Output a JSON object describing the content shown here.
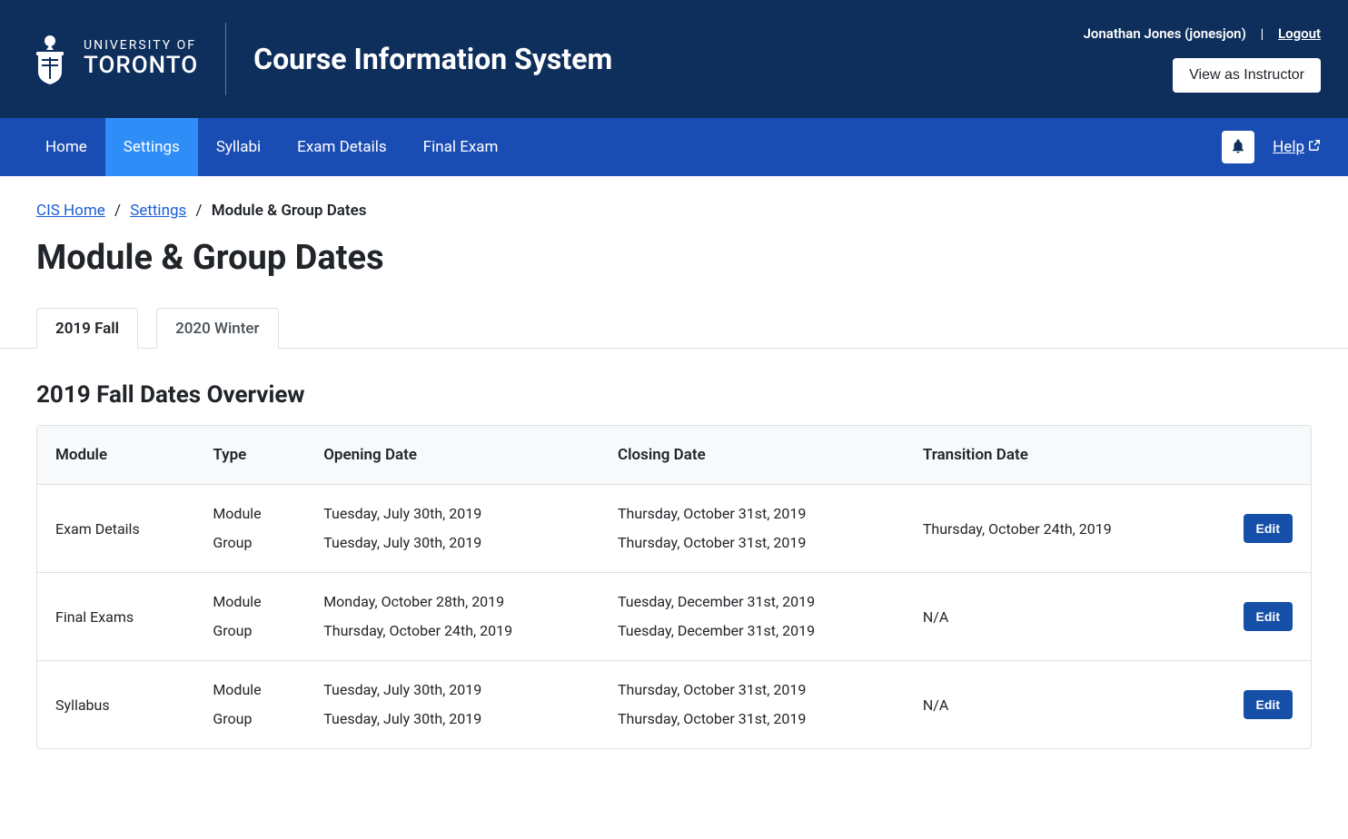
{
  "header": {
    "university_top": "UNIVERSITY OF",
    "university_bottom": "TORONTO",
    "system_title": "Course Information System",
    "user_label": "Jonathan Jones (jonesjon)",
    "logout_label": "Logout",
    "view_as_label": "View as Instructor"
  },
  "nav": {
    "items": [
      "Home",
      "Settings",
      "Syllabi",
      "Exam Details",
      "Final Exam"
    ],
    "active_index": 1,
    "help_label": "Help"
  },
  "breadcrumb": {
    "home": "CIS Home",
    "settings": "Settings",
    "current": "Module & Group Dates"
  },
  "page_title": "Module & Group Dates",
  "tabs": {
    "items": [
      "2019 Fall",
      "2020 Winter"
    ],
    "active_index": 0
  },
  "section_title": "2019 Fall Dates Overview",
  "table": {
    "headers": [
      "Module",
      "Type",
      "Opening Date",
      "Closing Date",
      "Transition Date",
      ""
    ],
    "type_labels": [
      "Module",
      "Group"
    ],
    "edit_label": "Edit",
    "rows": [
      {
        "module": "Exam Details",
        "opening": [
          "Tuesday, July 30th, 2019",
          "Tuesday, July 30th, 2019"
        ],
        "closing": [
          "Thursday, October 31st, 2019",
          "Thursday, October 31st, 2019"
        ],
        "transition": "Thursday, October 24th, 2019"
      },
      {
        "module": "Final Exams",
        "opening": [
          "Monday, October 28th, 2019",
          "Thursday, October 24th, 2019"
        ],
        "closing": [
          "Tuesday, December 31st, 2019",
          "Tuesday, December 31st, 2019"
        ],
        "transition": "N/A"
      },
      {
        "module": "Syllabus",
        "opening": [
          "Tuesday, July 30th, 2019",
          "Tuesday, July 30th, 2019"
        ],
        "closing": [
          "Thursday, October 31st, 2019",
          "Thursday, October 31st, 2019"
        ],
        "transition": "N/A"
      }
    ]
  }
}
